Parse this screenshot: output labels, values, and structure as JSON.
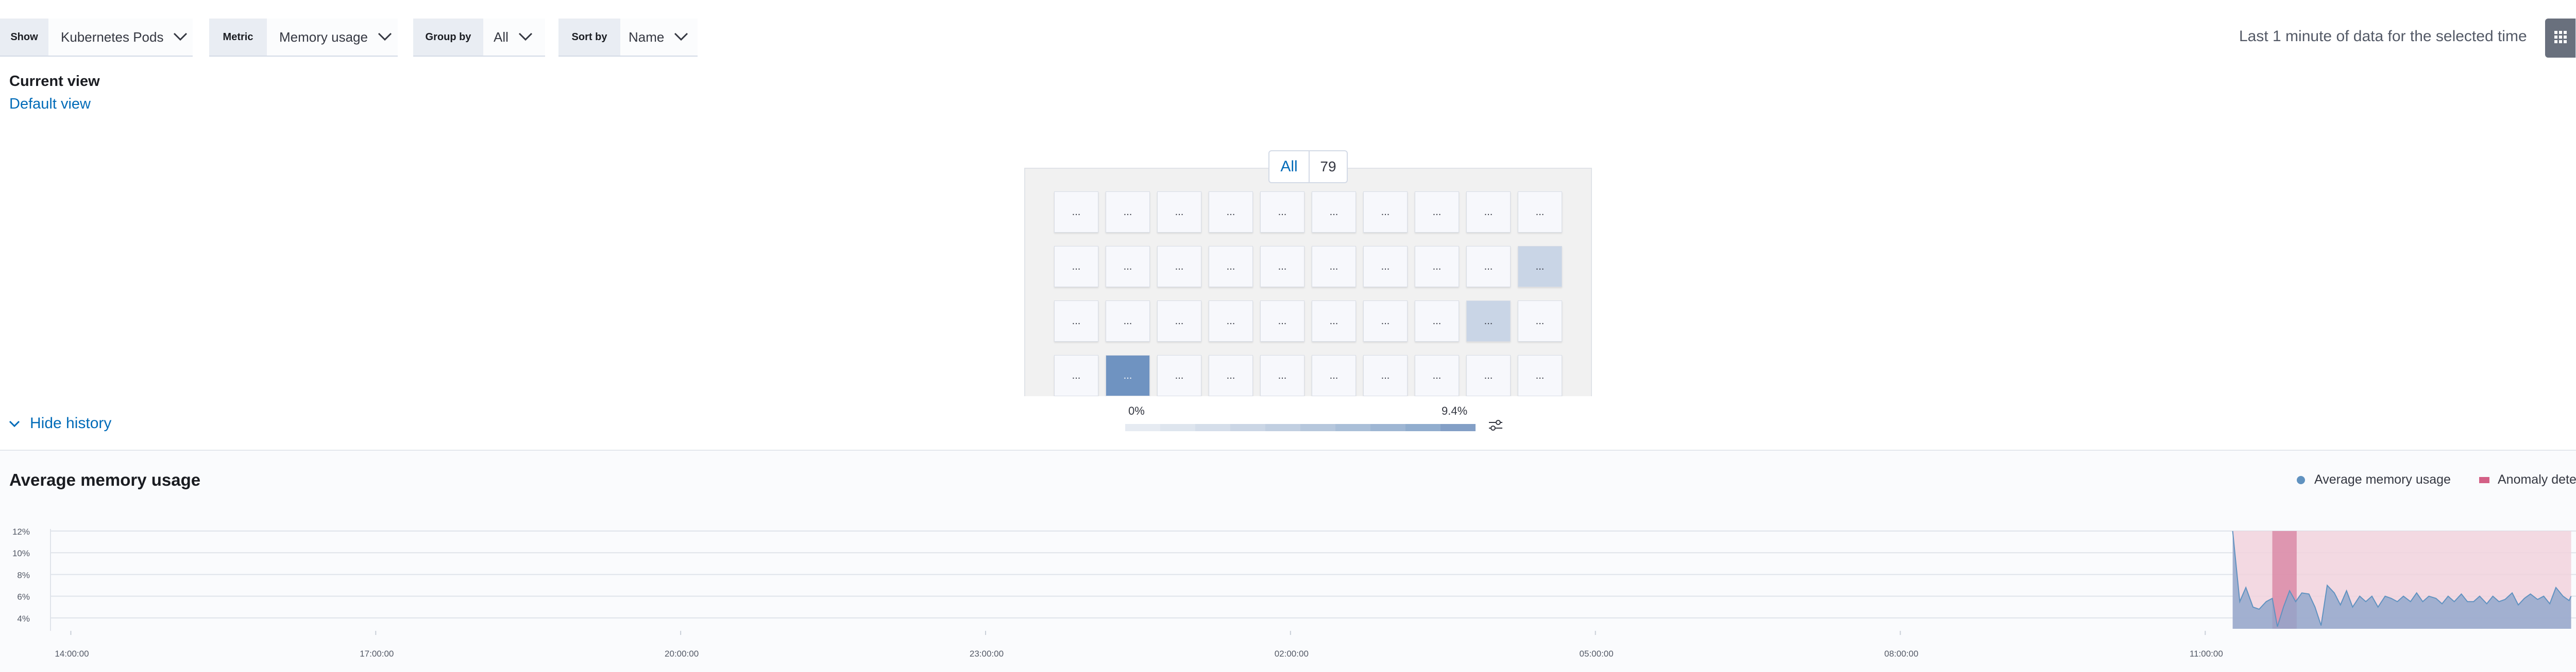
{
  "toolbar": {
    "filters": [
      {
        "label": "Show",
        "value": "Kubernetes Pods"
      },
      {
        "label": "Metric",
        "value": "Memory usage"
      },
      {
        "label": "Group by",
        "value": "All"
      },
      {
        "label": "Sort by",
        "value": "Name"
      }
    ],
    "time_info": "Last 1 minute of data for the selected time",
    "view_modes": [
      "map-view-icon",
      "table-view-icon"
    ]
  },
  "views": {
    "current_label": "Current view",
    "default_label": "Default view"
  },
  "waffle": {
    "group_name": "All",
    "group_count": "79",
    "node_label": "...",
    "rows": [
      [
        0,
        0,
        0,
        0,
        0,
        0,
        0,
        0,
        0,
        0
      ],
      [
        0,
        0,
        0,
        0,
        0,
        0,
        0,
        0,
        0,
        0.3
      ],
      [
        0,
        0,
        0,
        0,
        0,
        0,
        0,
        0,
        0.3,
        0
      ],
      [
        0,
        0.8,
        0,
        0,
        0,
        0,
        0,
        0,
        0,
        0
      ]
    ],
    "colors": {
      "empty": "#f7f8fc",
      "low": "#c9d5e6",
      "high": "#6f93c1"
    }
  },
  "legend": {
    "min": "0%",
    "max": "9.4%",
    "steps": [
      "#e6ebf2",
      "#dee5ee",
      "#d5deea",
      "#cbd6e5",
      "#c1cfe1",
      "#b6c7dc",
      "#aabfd8",
      "#9eb6d3",
      "#91adce",
      "#839fc6"
    ]
  },
  "history": {
    "toggle_label": "Hide history",
    "title": "Average memory usage",
    "legend": [
      {
        "label": "Average memory usage",
        "color": "#6092c0"
      },
      {
        "label": "Anomaly detected",
        "color": "#d36086"
      }
    ]
  },
  "chart_data": {
    "type": "area",
    "title": "Average memory usage",
    "y_ticks": [
      "4%",
      "6%",
      "8%",
      "10%",
      "12%"
    ],
    "x_ticks": [
      "14:00:00",
      "17:00:00",
      "20:00:00",
      "23:00:00",
      "02:00:00",
      "05:00:00",
      "08:00:00",
      "11:00:00"
    ],
    "ylim": [
      3,
      12
    ],
    "x_range_hours": [
      13.8,
      38.8
    ],
    "x_tick_hours": [
      14,
      17,
      20,
      23,
      26,
      29,
      32,
      35
    ],
    "series": [
      {
        "name": "Average memory usage",
        "color": "#6092c0",
        "points": [
          [
            35.27,
            12.0
          ],
          [
            35.34,
            5.5
          ],
          [
            35.4,
            6.8
          ],
          [
            35.47,
            5.0
          ],
          [
            35.53,
            4.8
          ],
          [
            35.6,
            5.5
          ],
          [
            35.66,
            5.8
          ],
          [
            35.71,
            3.2
          ],
          [
            35.77,
            5.0
          ],
          [
            35.83,
            6.5
          ],
          [
            35.89,
            5.5
          ],
          [
            35.95,
            6.3
          ],
          [
            36.02,
            6.2
          ],
          [
            36.08,
            5.0
          ],
          [
            36.14,
            3.3
          ],
          [
            36.2,
            7.0
          ],
          [
            36.27,
            6.3
          ],
          [
            36.33,
            5.2
          ],
          [
            36.39,
            6.5
          ],
          [
            36.45,
            5.0
          ],
          [
            36.52,
            6.0
          ],
          [
            36.58,
            5.5
          ],
          [
            36.64,
            6.0
          ],
          [
            36.7,
            5.0
          ],
          [
            36.77,
            6.0
          ],
          [
            36.83,
            5.8
          ],
          [
            36.89,
            5.5
          ],
          [
            36.95,
            6.0
          ],
          [
            37.02,
            5.5
          ],
          [
            37.08,
            6.3
          ],
          [
            37.14,
            5.5
          ],
          [
            37.2,
            6.0
          ],
          [
            37.27,
            5.8
          ],
          [
            37.33,
            5.3
          ],
          [
            37.39,
            6.0
          ],
          [
            37.45,
            5.5
          ],
          [
            37.52,
            6.2
          ],
          [
            37.58,
            5.5
          ],
          [
            37.64,
            5.5
          ],
          [
            37.7,
            6.0
          ],
          [
            37.77,
            5.3
          ],
          [
            37.83,
            6.0
          ],
          [
            37.89,
            5.5
          ],
          [
            37.95,
            5.7
          ],
          [
            38.02,
            6.3
          ],
          [
            38.08,
            5.2
          ],
          [
            38.14,
            5.8
          ],
          [
            38.2,
            6.2
          ],
          [
            38.27,
            5.7
          ],
          [
            38.33,
            6.0
          ],
          [
            38.39,
            5.3
          ],
          [
            38.45,
            6.8
          ],
          [
            38.52,
            6.0
          ],
          [
            38.58,
            5.6
          ],
          [
            38.6,
            6.0
          ]
        ]
      }
    ],
    "anomaly_range_hours": [
      35.27,
      38.6
    ],
    "anomaly_peak_hours": [
      35.66,
      35.9
    ],
    "grid": true
  }
}
